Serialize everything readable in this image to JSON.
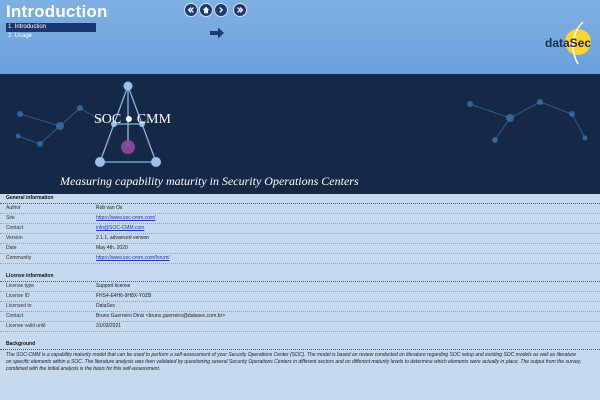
{
  "header": {
    "title": "Introduction",
    "nav_items": [
      "1. Introduction",
      "2. Usage"
    ],
    "logo_text": "dataSec",
    "colors": {
      "band": "#6aa0da",
      "button": "#1c3b72",
      "banner": "#142848"
    },
    "nav_buttons": [
      {
        "name": "first-page-button",
        "icon": "double-left-icon"
      },
      {
        "name": "home-button",
        "icon": "home-icon"
      },
      {
        "name": "next-page-button",
        "icon": "right-icon"
      },
      {
        "name": "last-page-button",
        "icon": "double-right-icon"
      }
    ]
  },
  "banner": {
    "title": "SOC ● CMM",
    "subtitle": "Measuring capability maturity in Security Operations Centers"
  },
  "general": {
    "heading": "General information",
    "rows": [
      {
        "label": "Author",
        "value": "Rob van Os"
      },
      {
        "label": "Site",
        "value": "https://www.soc-cmm.com/"
      },
      {
        "label": "Contact",
        "value": "info@SOC-CMM.com"
      },
      {
        "label": "Version",
        "value": "2.1.1, advanced version"
      },
      {
        "label": "Date",
        "value": "May 4th, 2020"
      },
      {
        "label": "Community",
        "value": "https://www.soc-cmm.com/forum/"
      }
    ]
  },
  "license": {
    "heading": "License information",
    "rows": [
      {
        "label": "License type",
        "value": "Support license"
      },
      {
        "label": "License ID",
        "value": "FHS4-E4H6-9H8X-Y0ZB"
      },
      {
        "label": "Licensed to",
        "value": "DataSec"
      },
      {
        "label": "Contact",
        "value": "Bruno Guerreiro Diniz <bruno.guerreiro@datasec.com.br>"
      },
      {
        "label": "License valid until",
        "value": "31/03/2021"
      }
    ]
  },
  "background": {
    "heading": "Background",
    "text": "The SOC-CMM is a capability maturity model that can be used to perform a self-assessment of your Security Operations Center (SOC). The model is based on review conducted on literature regarding SOC setup and existing SOC models as well as literature on specific elements within a SOC. The literature analysis was then validated by questioning several Security Operations Centers in different sectors and on different maturity levels to determine which elements were actually in place. The output from the survey, combined with the initial analysis is the basis for this self-assessment."
  }
}
